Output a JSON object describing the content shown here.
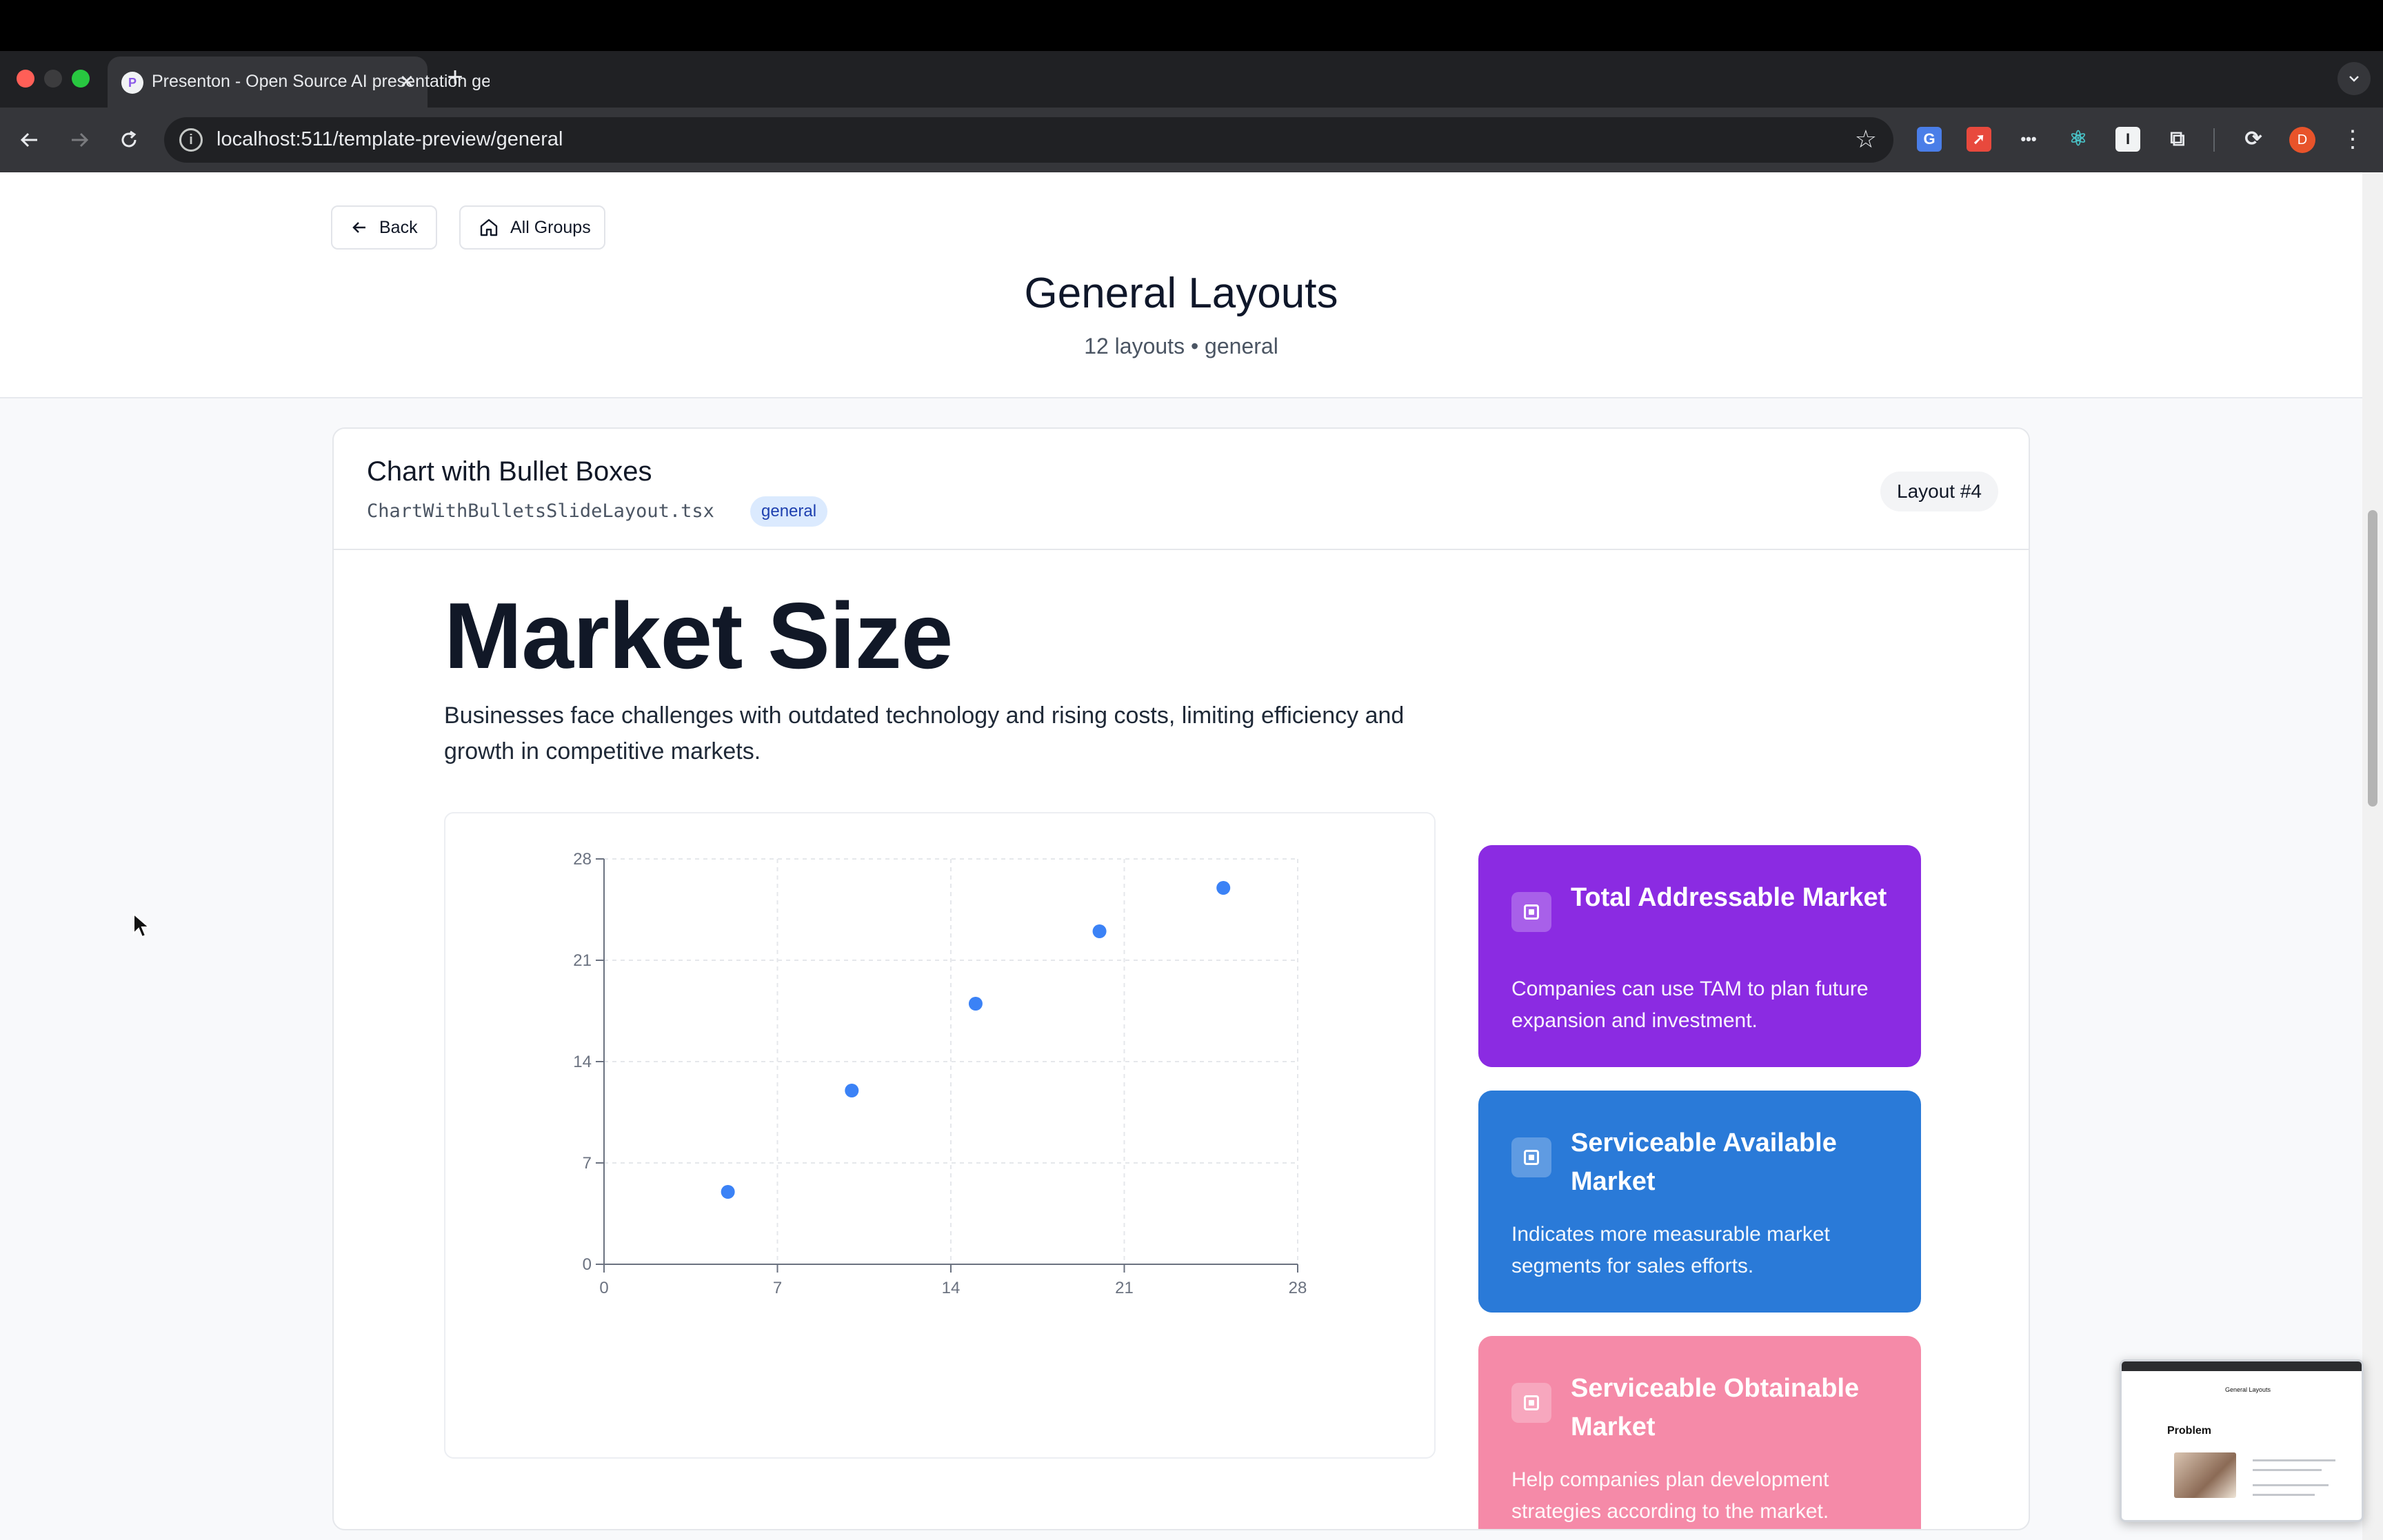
{
  "browser": {
    "tab_title": "Presenton - Open Source AI presentation generator",
    "tab_favicon": "P",
    "close_glyph": "✕",
    "newtab_glyph": "+",
    "url": "localhost:511/template-preview/general",
    "avatar_initial": "D",
    "extensions": [
      "translate-icon",
      "rocket-icon",
      "dots-icon",
      "react-icon",
      "i-icon",
      "puzzle-icon",
      "sync-icon"
    ]
  },
  "header": {
    "back_label": "Back",
    "all_groups_label": "All Groups",
    "title": "General Layouts",
    "subtitle": "12 layouts • general"
  },
  "card": {
    "title": "Chart with Bullet Boxes",
    "file": "ChartWithBulletsSlideLayout.tsx",
    "tag": "general",
    "layout_number": "Layout #4"
  },
  "slide": {
    "title": "Market Size",
    "description": "Businesses face challenges with outdated technology and rising costs, limiting efficiency and growth in competitive markets.",
    "bullets": [
      {
        "title": "Total Addressable Market",
        "text": "Companies can use TAM to plan future expansion and investment.",
        "color": "#8b2be2"
      },
      {
        "title": "Serviceable Available Market",
        "text": "Indicates more measurable market segments for sales efforts.",
        "color": "#2a7ad8"
      },
      {
        "title": "Serviceable Obtainable Market",
        "text": "Help companies plan development strategies according to the market.",
        "color": "#f58aa8"
      }
    ]
  },
  "chart_data": {
    "type": "scatter",
    "title": "",
    "xlabel": "",
    "ylabel": "",
    "xlim": [
      0,
      28
    ],
    "ylim": [
      0,
      28
    ],
    "x_ticks": [
      "0",
      "7",
      "14",
      "21",
      "28"
    ],
    "y_ticks": [
      "0",
      "7",
      "14",
      "21",
      "28"
    ],
    "grid": true,
    "series": [
      {
        "color": "#3b82f6",
        "points": [
          [
            5,
            5
          ],
          [
            10,
            12
          ],
          [
            15,
            18
          ],
          [
            20,
            23
          ],
          [
            25,
            26
          ]
        ]
      }
    ]
  },
  "thumbnail": {
    "page_title": "General Layouts",
    "slide_title": "Problem"
  }
}
